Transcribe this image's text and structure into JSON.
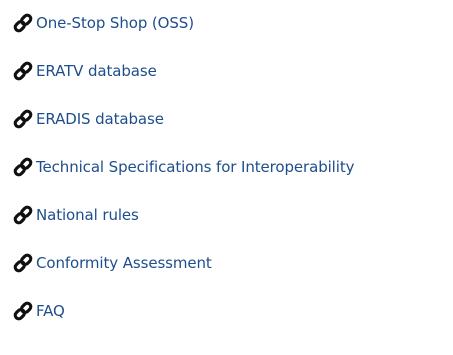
{
  "colors": {
    "link": "#1f4e8c",
    "icon": "#111111",
    "background": "#ffffff"
  },
  "links": [
    {
      "label": "One-Stop Shop (OSS)",
      "icon": "link-icon"
    },
    {
      "label": "ERATV database",
      "icon": "link-icon"
    },
    {
      "label": "ERADIS database",
      "icon": "link-icon"
    },
    {
      "label": "Technical Specifications for Interoperability",
      "icon": "link-icon"
    },
    {
      "label": "National rules",
      "icon": "link-icon"
    },
    {
      "label": "Conformity Assessment",
      "icon": "link-icon"
    },
    {
      "label": "FAQ",
      "icon": "link-icon"
    }
  ]
}
